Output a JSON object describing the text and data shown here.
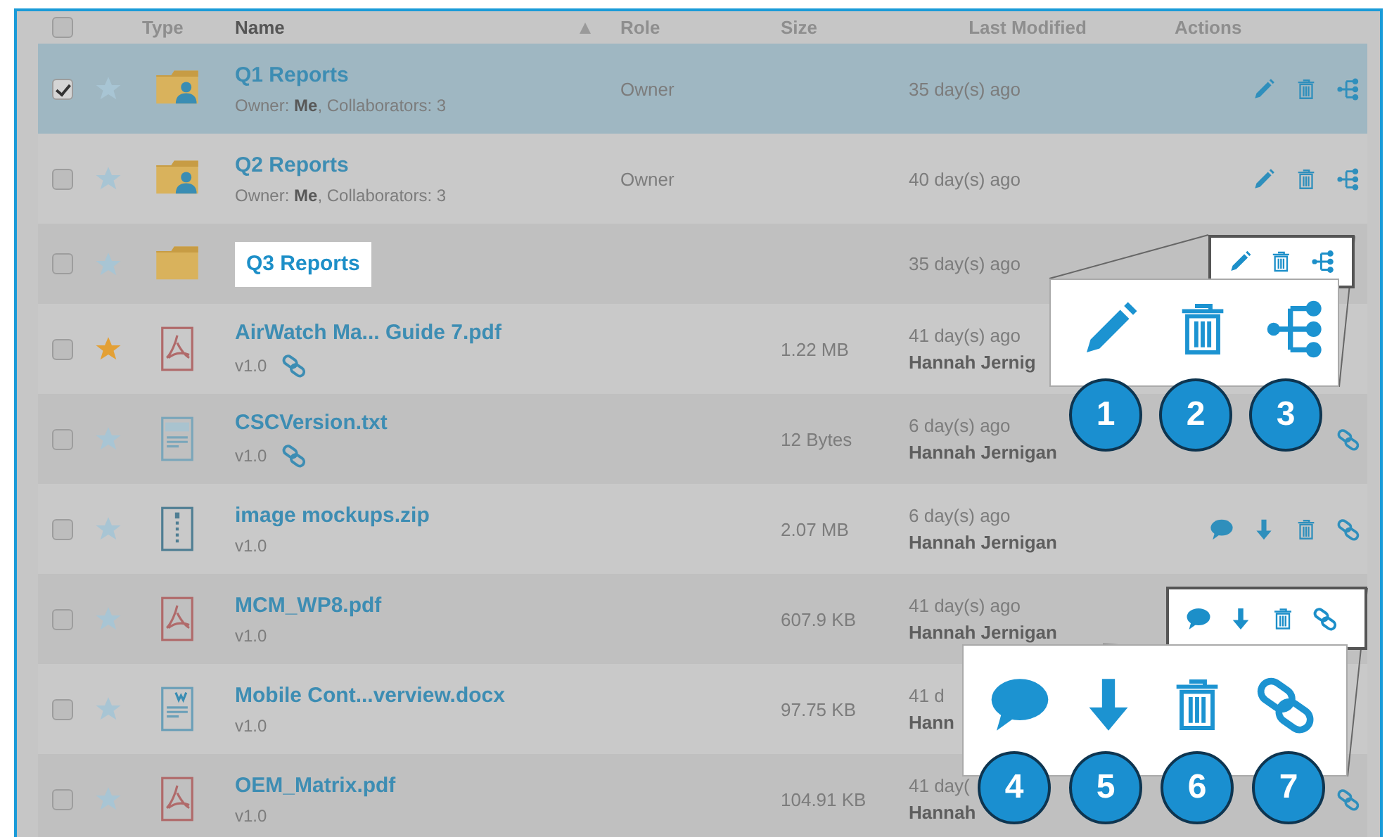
{
  "table": {
    "columns": [
      {
        "label": "Type"
      },
      {
        "label": "Name",
        "sorted": true
      },
      {
        "label": "Role"
      },
      {
        "label": "Size"
      },
      {
        "label": "Last Modified"
      },
      {
        "label": "Actions"
      }
    ],
    "header_checked": false,
    "rows": [
      {
        "kind": "shared-folder",
        "name": "Q1 Reports",
        "sub": "Owner: **Me**, Collaborators: 3",
        "role": "Owner",
        "modified": "35 day(s) ago",
        "checked": true,
        "selected": true,
        "starred": false,
        "actions": [
          {
            "kind": "edit"
          },
          {
            "kind": "trash"
          },
          {
            "kind": "share"
          }
        ]
      },
      {
        "kind": "shared-folder",
        "name": "Q2 Reports",
        "sub": "Owner: **Me**, Collaborators: 3",
        "role": "Owner",
        "modified": "40 day(s) ago",
        "checked": false,
        "selected": false,
        "starred": false,
        "actions": [
          {
            "kind": "edit"
          },
          {
            "kind": "trash"
          },
          {
            "kind": "share"
          }
        ]
      },
      {
        "kind": "folder",
        "name": "Q3 Reports",
        "highlighted": true,
        "modified": "35 day(s) ago",
        "checked": false,
        "selected": false,
        "starred": false
      },
      {
        "kind": "pdf",
        "name": "AirWatch Ma... Guide 7.pdf",
        "sub": "v1.0",
        "link": true,
        "size": "1.22 MB",
        "modified": "41 day(s) ago",
        "modified_by": "Hannah Jernig",
        "checked": false,
        "selected": false,
        "starred": true
      },
      {
        "kind": "text",
        "name": "CSCVersion.txt",
        "sub": "v1.0",
        "link": true,
        "size": "12 Bytes",
        "modified": "6 day(s) ago",
        "modified_by": "Hannah Jernigan",
        "checked": false,
        "selected": false,
        "starred": false,
        "actions": [
          {
            "kind": "link"
          }
        ]
      },
      {
        "kind": "zip",
        "name": "image mockups.zip",
        "sub": "v1.0",
        "size": "2.07 MB",
        "modified": "6 day(s) ago",
        "modified_by": "Hannah Jernigan",
        "checked": false,
        "selected": false,
        "starred": false,
        "actions": [
          {
            "kind": "comment"
          },
          {
            "kind": "download"
          },
          {
            "kind": "trash"
          },
          {
            "kind": "link"
          }
        ]
      },
      {
        "kind": "pdf",
        "name": "MCM_WP8.pdf",
        "sub": "v1.0",
        "size": "607.9 KB",
        "modified": "41 day(s) ago",
        "modified_by": "Hannah Jernigan",
        "checked": false,
        "selected": false,
        "starred": false
      },
      {
        "kind": "doc",
        "name": "Mobile Cont...verview.docx",
        "sub": "v1.0",
        "size": "97.75 KB",
        "modified": "41 d",
        "modified_by": "Hann",
        "checked": false,
        "selected": false,
        "starred": false
      },
      {
        "kind": "pdf",
        "name": "OEM_Matrix.pdf",
        "sub": "v1.0",
        "size": "104.91 KB",
        "modified": "41 day(",
        "modified_by": "Hannah",
        "checked": false,
        "selected": false,
        "starred": false,
        "actions": [
          {
            "kind": "link"
          }
        ]
      }
    ]
  },
  "callouts": [
    {
      "actions": [
        {
          "kind": "edit",
          "number": "1"
        },
        {
          "kind": "trash",
          "number": "2"
        },
        {
          "kind": "share",
          "number": "3"
        }
      ]
    },
    {
      "actions": [
        {
          "kind": "comment",
          "number": "4"
        },
        {
          "kind": "download",
          "number": "5"
        },
        {
          "kind": "trash",
          "number": "6"
        },
        {
          "kind": "link",
          "number": "7"
        }
      ]
    }
  ]
}
